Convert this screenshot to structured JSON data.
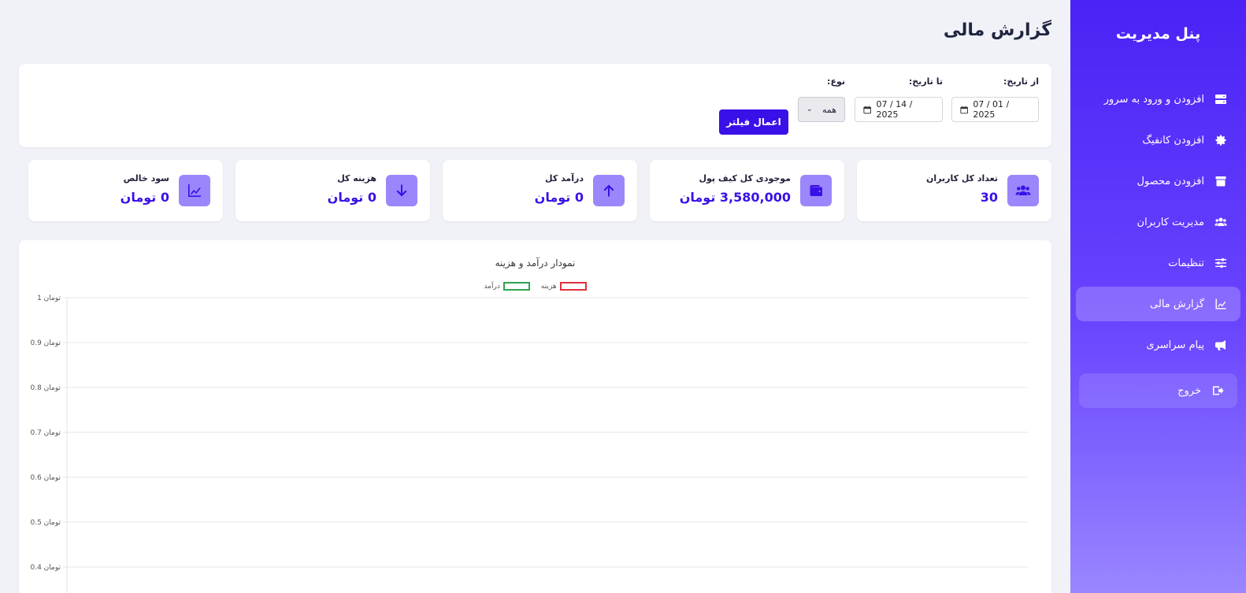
{
  "sidebar": {
    "brand": "پنل مدیریت",
    "items": [
      {
        "label": "افزودن و ورود به سرور",
        "icon": "server-icon"
      },
      {
        "label": "افزودن کانفیگ",
        "icon": "gear-icon"
      },
      {
        "label": "افزودن محصول",
        "icon": "box-icon"
      },
      {
        "label": "مدیریت کاربران",
        "icon": "users-icon"
      },
      {
        "label": "تنظیمات",
        "icon": "sliders-icon"
      },
      {
        "label": "گزارش مالی",
        "icon": "chart-line-icon",
        "active": true
      },
      {
        "label": "پیام سراسری",
        "icon": "megaphone-icon"
      }
    ],
    "logout": {
      "label": "خروج",
      "icon": "sign-out-icon"
    }
  },
  "page": {
    "title": "گزارش مالی"
  },
  "filter": {
    "from_label": "از تاریخ:",
    "from_value": "07 / 01 / 2025",
    "to_label": "تا تاریخ:",
    "to_value": "07 / 14 / 2025",
    "type_label": "نوع:",
    "type_value": "همه",
    "apply_label": "اعمال فیلتر"
  },
  "stats": [
    {
      "label": "تعداد کل کاربران",
      "value": "30",
      "icon": "users-icon"
    },
    {
      "label": "موجودی کل کیف پول",
      "value": "3,580,000 تومان",
      "icon": "wallet-icon"
    },
    {
      "label": "درآمد کل",
      "value": "0 تومان",
      "icon": "arrow-up-icon"
    },
    {
      "label": "هزینه کل",
      "value": "0 تومان",
      "icon": "arrow-down-icon"
    },
    {
      "label": "سود خالص",
      "value": "0 تومان",
      "icon": "chart-line-icon"
    }
  ],
  "colors": {
    "accent": "#3a10e8",
    "icon_bg": "#9c86fb",
    "income": "#2ea44f",
    "expense": "#e0303c"
  },
  "chart_data": {
    "type": "line",
    "title": "نمودار درآمد و هزینه",
    "series": [
      {
        "name": "هزینه",
        "values": [],
        "color": "#e0303c"
      },
      {
        "name": "درآمد",
        "values": [],
        "color": "#2ea44f"
      }
    ],
    "y_ticks": [
      "1 تومان",
      "0.9 تومان",
      "0.8 تومان",
      "0.7 تومان",
      "0.6 تومان",
      "0.5 تومان",
      "0.4 تومان"
    ],
    "y_tick_values": [
      1,
      0.9,
      0.8,
      0.7,
      0.6,
      0.5,
      0.4
    ],
    "ylim": [
      0,
      1
    ],
    "grid": true,
    "legend_placement": "top-center"
  }
}
